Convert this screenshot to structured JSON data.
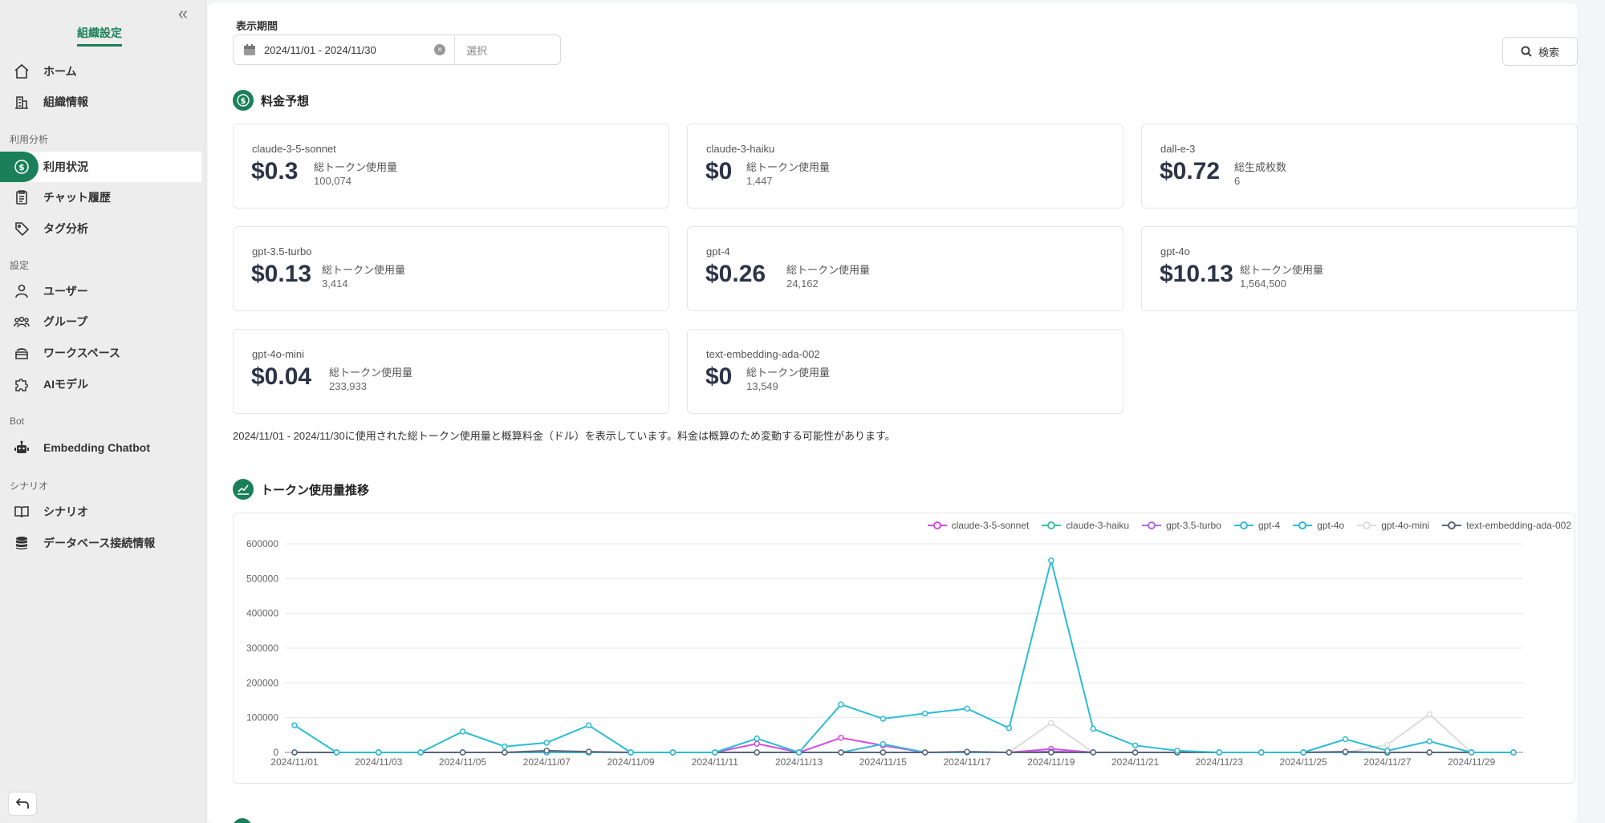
{
  "sidebar": {
    "title": "組織設定",
    "sections": {
      "analysis": "利用分析",
      "settings": "設定",
      "bot": "Bot",
      "scenario": "シナリオ"
    },
    "items": [
      {
        "label": "ホーム",
        "icon": "home-icon"
      },
      {
        "label": "組織情報",
        "icon": "building-icon"
      },
      {
        "label": "利用状況",
        "icon": "dollar-icon",
        "active": true
      },
      {
        "label": "チャット履歴",
        "icon": "clipboard-icon"
      },
      {
        "label": "タグ分析",
        "icon": "tag-icon"
      },
      {
        "label": "ユーザー",
        "icon": "user-icon"
      },
      {
        "label": "グループ",
        "icon": "group-icon"
      },
      {
        "label": "ワークスペース",
        "icon": "workspace-icon"
      },
      {
        "label": "AIモデル",
        "icon": "puzzle-icon"
      },
      {
        "label": "Embedding Chatbot",
        "icon": "robot-icon"
      },
      {
        "label": "シナリオ",
        "icon": "book-icon"
      },
      {
        "label": "データベース接続情報",
        "icon": "database-icon"
      }
    ]
  },
  "filter": {
    "label": "表示期間",
    "range": "2024/11/01 - 2024/11/30",
    "select_placeholder": "選択",
    "search_label": "検索"
  },
  "forecast": {
    "title": "料金予想",
    "cards": [
      {
        "model": "claude-3-5-sonnet",
        "price": "$0.3",
        "metric": "総トークン使用量",
        "value": "100,074"
      },
      {
        "model": "claude-3-haiku",
        "price": "$0",
        "metric": "総トークン使用量",
        "value": "1,447"
      },
      {
        "model": "dall-e-3",
        "price": "$0.72",
        "metric": "総生成枚数",
        "value": "6"
      },
      {
        "model": "gpt-3.5-turbo",
        "price": "$0.13",
        "metric": "総トークン使用量",
        "value": "3,414"
      },
      {
        "model": "gpt-4",
        "price": "$0.26",
        "metric": "総トークン使用量",
        "value": "24,162"
      },
      {
        "model": "gpt-4o",
        "price": "$10.13",
        "metric": "総トークン使用量",
        "value": "1,564,500"
      },
      {
        "model": "gpt-4o-mini",
        "price": "$0.04",
        "metric": "総トークン使用量",
        "value": "233,933"
      },
      {
        "model": "text-embedding-ada-002",
        "price": "$0",
        "metric": "総トークン使用量",
        "value": "13,549"
      }
    ],
    "note": "2024/11/01 - 2024/11/30に使用された総トークン使用量と概算料金（ドル）を表示しています。料金は概算のため変動する可能性があります。"
  },
  "trend": {
    "title": "トークン使用量推移"
  },
  "chart_data": {
    "type": "line",
    "title": "",
    "xlabel": "",
    "ylabel": "",
    "ylim": [
      0,
      600000
    ],
    "yticks": [
      0,
      100000,
      200000,
      300000,
      400000,
      500000,
      600000
    ],
    "x": [
      "2024/11/01",
      "2024/11/02",
      "2024/11/03",
      "2024/11/04",
      "2024/11/05",
      "2024/11/06",
      "2024/11/07",
      "2024/11/08",
      "2024/11/09",
      "2024/11/10",
      "2024/11/11",
      "2024/11/12",
      "2024/11/13",
      "2024/11/14",
      "2024/11/15",
      "2024/11/16",
      "2024/11/17",
      "2024/11/18",
      "2024/11/19",
      "2024/11/20",
      "2024/11/21",
      "2024/11/22",
      "2024/11/23",
      "2024/11/24",
      "2024/11/25",
      "2024/11/26",
      "2024/11/27",
      "2024/11/28",
      "2024/11/29",
      "2024/11/30"
    ],
    "xtick_labels": [
      "2024/11/01",
      "2024/11/03",
      "2024/11/05",
      "2024/11/07",
      "2024/11/09",
      "2024/11/11",
      "2024/11/13",
      "2024/11/15",
      "2024/11/17",
      "2024/11/19",
      "2024/11/21",
      "2024/11/23",
      "2024/11/25",
      "2024/11/27",
      "2024/11/29"
    ],
    "legend_position": "top-right",
    "series": [
      {
        "name": "claude-3-5-sonnet",
        "color": "#d44ee0",
        "values": [
          0,
          0,
          0,
          0,
          0,
          0,
          0,
          0,
          0,
          0,
          0,
          25000,
          0,
          42000,
          20000,
          0,
          0,
          0,
          10000,
          0,
          0,
          0,
          0,
          0,
          0,
          0,
          0,
          0,
          0,
          0
        ]
      },
      {
        "name": "claude-3-haiku",
        "color": "#3cc0a0",
        "values": [
          0,
          0,
          0,
          0,
          0,
          0,
          0,
          0,
          0,
          0,
          0,
          0,
          0,
          0,
          0,
          0,
          0,
          0,
          0,
          0,
          0,
          0,
          0,
          0,
          0,
          0,
          0,
          0,
          0,
          0
        ]
      },
      {
        "name": "gpt-3.5-turbo",
        "color": "#b06be8",
        "values": [
          0,
          0,
          0,
          0,
          0,
          0,
          0,
          0,
          0,
          0,
          0,
          0,
          0,
          0,
          0,
          0,
          0,
          0,
          3000,
          0,
          0,
          0,
          0,
          0,
          0,
          0,
          0,
          0,
          0,
          0
        ]
      },
      {
        "name": "gpt-4",
        "color": "#3bb8d6",
        "values": [
          0,
          0,
          0,
          0,
          0,
          0,
          0,
          0,
          0,
          0,
          0,
          0,
          0,
          0,
          24000,
          0,
          0,
          0,
          0,
          0,
          0,
          0,
          0,
          0,
          0,
          0,
          0,
          0,
          0,
          0
        ]
      },
      {
        "name": "gpt-4o",
        "color": "#2bbcd4",
        "values": [
          78000,
          0,
          0,
          0,
          60000,
          17000,
          28000,
          78000,
          0,
          0,
          0,
          40000,
          0,
          138000,
          97000,
          112000,
          126000,
          70000,
          552000,
          68000,
          20000,
          5000,
          0,
          0,
          0,
          38000,
          5000,
          32000,
          0,
          0
        ]
      },
      {
        "name": "gpt-4o-mini",
        "color": "#dcdcdc",
        "values": [
          0,
          0,
          0,
          0,
          0,
          0,
          0,
          0,
          0,
          0,
          0,
          0,
          0,
          0,
          0,
          0,
          0,
          0,
          85000,
          0,
          0,
          0,
          0,
          0,
          0,
          0,
          22000,
          110000,
          0,
          0
        ]
      },
      {
        "name": "text-embedding-ada-002",
        "color": "#5b6478",
        "values": [
          0,
          0,
          0,
          0,
          0,
          0,
          5000,
          2000,
          0,
          0,
          0,
          0,
          0,
          0,
          0,
          0,
          2000,
          0,
          0,
          0,
          0,
          0,
          0,
          0,
          0,
          2000,
          0,
          0,
          0,
          0
        ]
      }
    ]
  }
}
